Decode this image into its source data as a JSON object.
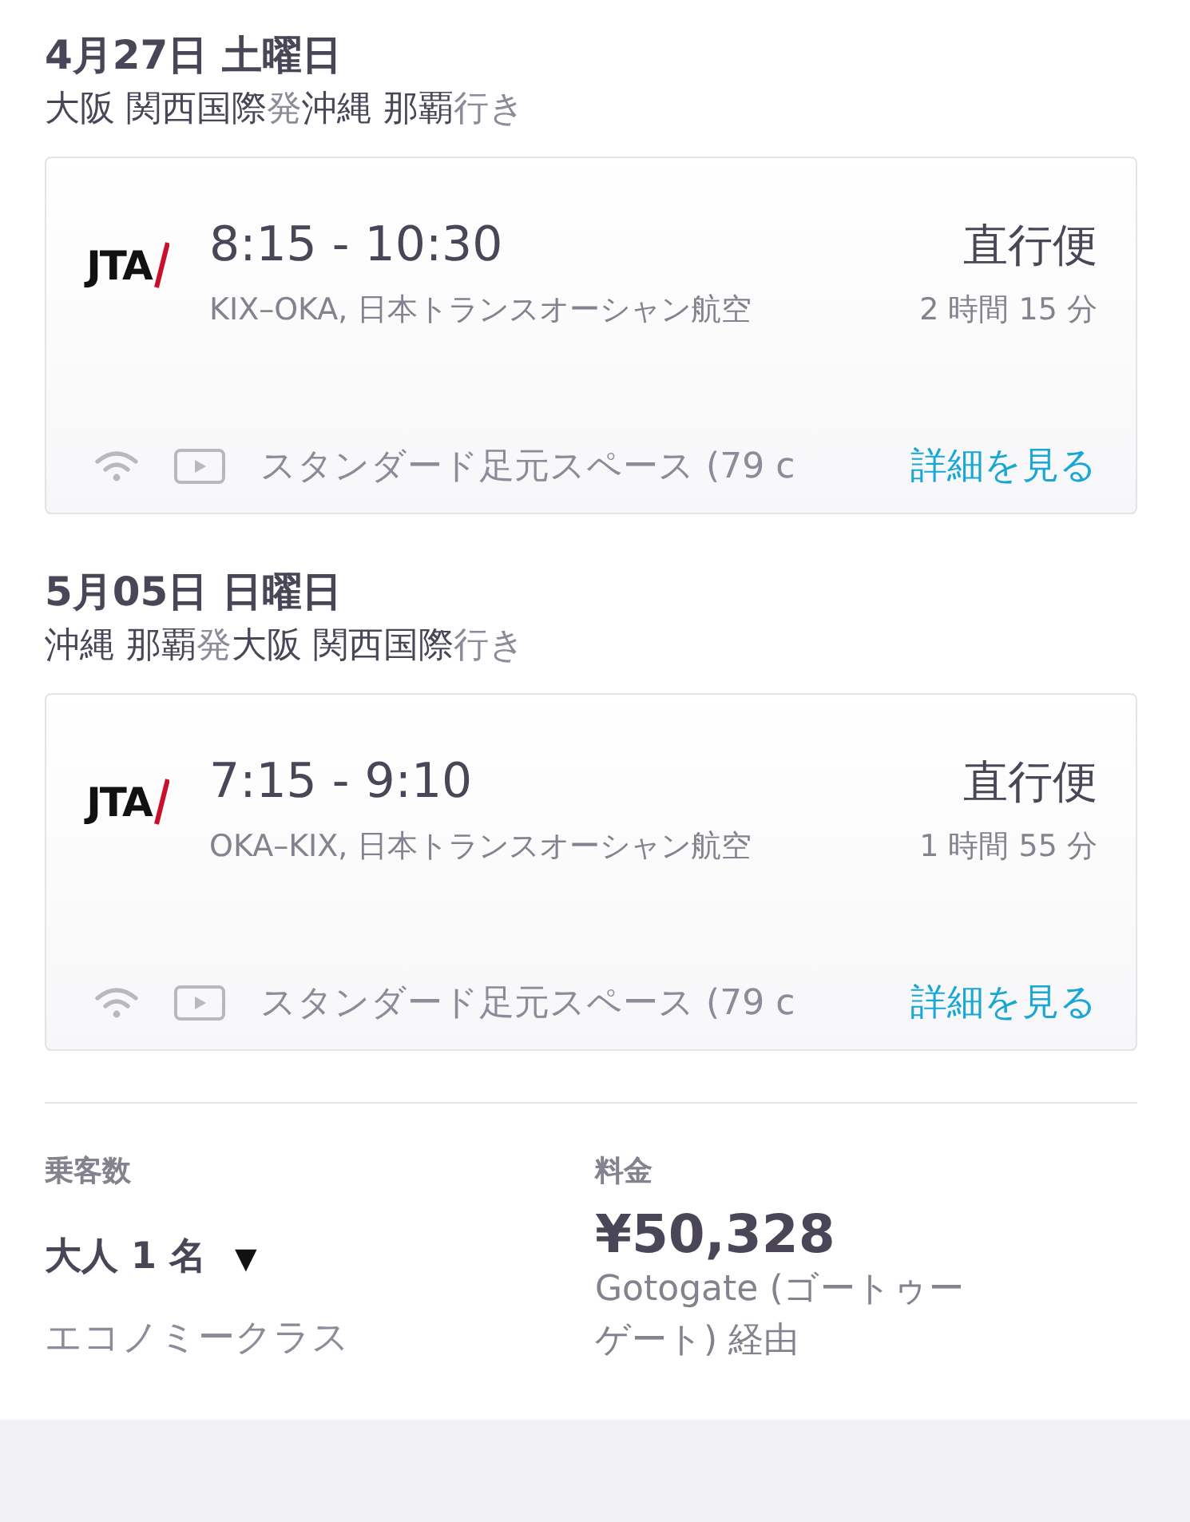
{
  "legs": [
    {
      "date": "4月27日 土曜日",
      "route": [
        {
          "kind": "place",
          "text": "大阪 関西国際"
        },
        {
          "kind": "particle",
          "text": "発"
        },
        {
          "kind": "place",
          "text": "沖縄 那覇"
        },
        {
          "kind": "particle",
          "text": "行き"
        }
      ],
      "airline_logo": "JTA",
      "times": "8:15 - 10:30",
      "stops": "直行便",
      "details": "KIX–OKA, 日本トランスオーシャン航空",
      "duration": "2 時間 15 分",
      "amenity": "スタンダード足元スペース (79 c",
      "link": "詳細を見る"
    },
    {
      "date": "5月05日 日曜日",
      "route": [
        {
          "kind": "place",
          "text": "沖縄 那覇"
        },
        {
          "kind": "particle",
          "text": "発"
        },
        {
          "kind": "place",
          "text": "大阪 関西国際"
        },
        {
          "kind": "particle",
          "text": "行き"
        }
      ],
      "airline_logo": "JTA",
      "times": "7:15 - 9:10",
      "stops": "直行便",
      "details": "OKA–KIX, 日本トランスオーシャン航空",
      "duration": "1 時間 55 分",
      "amenity": "スタンダード足元スペース (79 c",
      "link": "詳細を見る"
    }
  ],
  "passengers": {
    "label": "乗客数",
    "value": "大人 1 名",
    "caret": "▼",
    "cabin": "エコノミークラス"
  },
  "price": {
    "label": "料金",
    "amount": "¥50,328",
    "via": "Gotogate (ゴートゥーゲート) 経由"
  }
}
